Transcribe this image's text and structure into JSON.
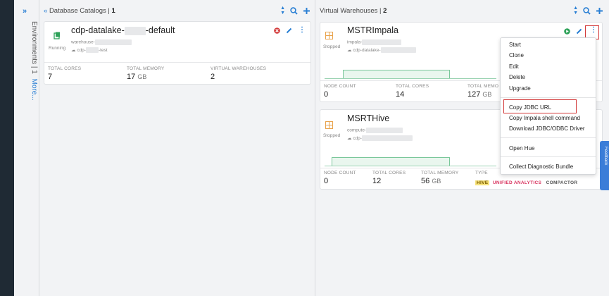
{
  "env": {
    "label": "Environments | 1",
    "more": "More..."
  },
  "catalogs": {
    "title": "Database Catalogs | ",
    "count": "1",
    "card": {
      "name_prefix": "cdp-datalake-",
      "name_suffix": "-default",
      "status": "Running",
      "sub1": "warehouse-",
      "sub2": "cdp-",
      "sub2_suffix": "-test",
      "stats": [
        {
          "label": "TOTAL CORES",
          "value": "7",
          "unit": ""
        },
        {
          "label": "TOTAL MEMORY",
          "value": "17",
          "unit": "GB"
        },
        {
          "label": "VIRTUAL WAREHOUSES",
          "value": "2",
          "unit": ""
        }
      ]
    }
  },
  "warehouses": {
    "title": "Virtual Warehouses | ",
    "count": "2",
    "cards": [
      {
        "name": "MSTRImpala",
        "status": "Stopped",
        "sub1": "impala-",
        "sub2": "cdp-datalake-",
        "stats": [
          {
            "label": "NODE COUNT",
            "value": "0",
            "unit": ""
          },
          {
            "label": "TOTAL CORES",
            "value": "14",
            "unit": ""
          },
          {
            "label": "TOTAL MEMO",
            "value": "127",
            "unit": "GB"
          }
        ]
      },
      {
        "name": "MSRTHive",
        "status": "Stopped",
        "sub1": "compute-",
        "sub2": "cdp-",
        "stats": [
          {
            "label": "NODE COUNT",
            "value": "0",
            "unit": ""
          },
          {
            "label": "TOTAL CORES",
            "value": "12",
            "unit": ""
          },
          {
            "label": "TOTAL MEMORY",
            "value": "56",
            "unit": "GB"
          },
          {
            "label": "TYPE",
            "value": "",
            "unit": ""
          }
        ],
        "tags": [
          "HIVE",
          "UNIFIED ANALYTICS",
          "COMPACTOR"
        ]
      }
    ]
  },
  "menu": {
    "items": [
      "Start",
      "Clone",
      "Edit",
      "Delete",
      "Upgrade",
      "Copy JDBC URL",
      "Copy Impala shell command",
      "Download JDBC/ODBC Driver",
      "Open Hue",
      "Collect Diagnostic Bundle"
    ]
  },
  "feedback": "Feedback",
  "colors": {
    "accent": "#2a7fd4",
    "danger": "#d23838",
    "running": "#2fa25a",
    "highlight": "#d23838",
    "tag_hive": "#f6e27a",
    "tag_unified": "#d8345f"
  }
}
